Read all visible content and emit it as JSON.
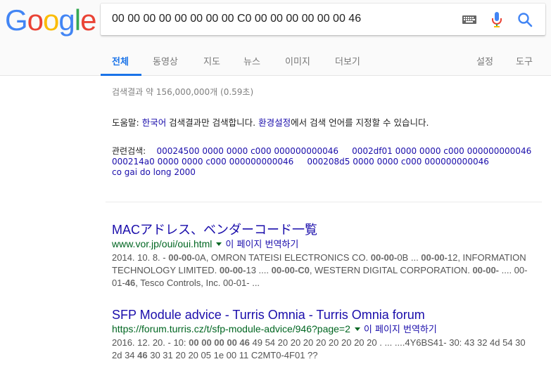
{
  "logo": {
    "letters": [
      "G",
      "o",
      "o",
      "g",
      "l",
      "e"
    ],
    "colors": [
      "#4285f4",
      "#ea4335",
      "#fbbc05",
      "#4285f4",
      "#34a853",
      "#ea4335"
    ]
  },
  "search": {
    "query": "00 00 00 00 00 00 00 00 C0 00 00 00 00 00 00 46"
  },
  "tabs": [
    {
      "label": "전체"
    },
    {
      "label": "동영상"
    },
    {
      "label": "지도"
    },
    {
      "label": "뉴스"
    },
    {
      "label": "이미지"
    },
    {
      "label": "더보기"
    },
    {
      "label": "설정"
    },
    {
      "label": "도구"
    }
  ],
  "stats": "검색결과 약 156,000,000개 (0.59초)",
  "help": {
    "prefix": "도움말: ",
    "language": "한국어",
    "mid": " 검색결과만 검색합니다. ",
    "settings": "환경설정",
    "suffix": "에서 검색 언어를 지정할 수 있습니다."
  },
  "related": {
    "label": "관련검색:",
    "items": [
      "00024500 0000 0000 c000 000000000046",
      "0002df01 0000 0000 c000 000000000046",
      "000214a0 0000 0000 c000 000000000046",
      "000208d5 0000 0000 c000 000000000046",
      "co gai do long 2000"
    ]
  },
  "results": [
    {
      "title": "MACアドレス、ベンダーコード一覧",
      "url": "www.vor.jp/oui/oui.html",
      "translate": "이 페이지 번역하기",
      "snippet": [
        {
          "text": "2014. 10. 8. - ",
          "b": false
        },
        {
          "text": "00-00-",
          "b": true
        },
        {
          "text": "0A, OMRON TATEISI ELECTRONICS CO. ",
          "b": false
        },
        {
          "text": "00-00-",
          "b": true
        },
        {
          "text": "0B ... ",
          "b": false
        },
        {
          "text": "00-00-",
          "b": true
        },
        {
          "text": "12, INFORMATION TECHNOLOGY LIMITED. ",
          "b": false
        },
        {
          "text": "00-00-",
          "b": true
        },
        {
          "text": "13 .... ",
          "b": false
        },
        {
          "text": "00-00-C0",
          "b": true
        },
        {
          "text": ", WESTERN DIGITAL CORPORATION. ",
          "b": false
        },
        {
          "text": "00-00-",
          "b": true
        },
        {
          "text": " .... 00-01-",
          "b": false
        },
        {
          "text": "46",
          "b": true
        },
        {
          "text": ", Tesco Controls, Inc. 00-01- ...",
          "b": false
        }
      ]
    },
    {
      "title": "SFP Module advice - Turris Omnia - Turris Omnia forum",
      "url": "https://forum.turris.cz/t/sfp-module-advice/946?page=2",
      "translate": "이 페이지 번역하기",
      "snippet": [
        {
          "text": "2016. 12. 20. - 10: ",
          "b": false
        },
        {
          "text": "00 00 00 00 46",
          "b": true
        },
        {
          "text": " 49 54 20 20 20 20 20 20 20 20 . ... ....4Y6BS41- 30: 43 32 4d 54 30 2d 34 ",
          "b": false
        },
        {
          "text": "46",
          "b": true
        },
        {
          "text": " 30 31 20 20 05 1e 00 11 C2MT0-4F01 ??",
          "b": false
        }
      ]
    }
  ],
  "colors": {
    "link": "#1a0dab",
    "url": "#006621",
    "accent": "#1a73e8",
    "snippet": "#545454"
  }
}
